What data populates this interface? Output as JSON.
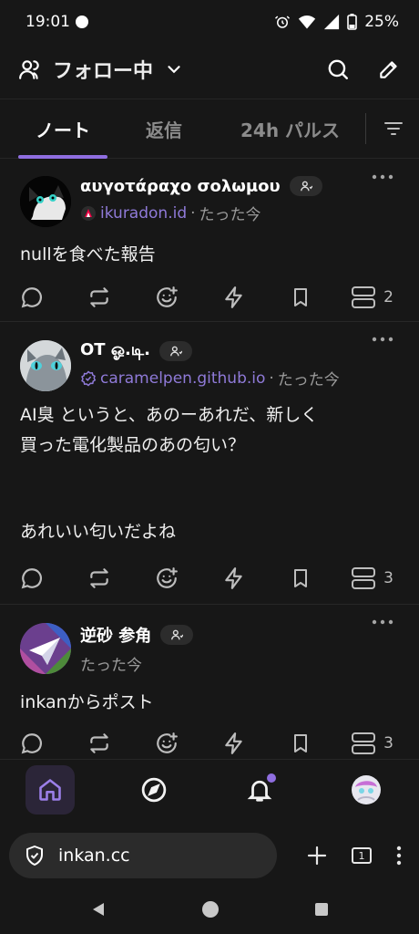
{
  "status_bar": {
    "time": "19:01",
    "battery": "25%"
  },
  "header": {
    "feed_title": "フォロー中"
  },
  "tabs": [
    {
      "label": "ノート",
      "active": true
    },
    {
      "label": "返信",
      "active": false
    },
    {
      "label": "24h パルス",
      "active": false
    }
  ],
  "posts": [
    {
      "display_name": "αυγοτάραχο σολωμου",
      "instance": "ikuradon.id",
      "time": "たった今",
      "text": "nullを食べた報告",
      "server_count": "2"
    },
    {
      "display_name": "OT ஓ.டி.",
      "instance": "caramelpen.github.io",
      "time": "たった今",
      "text_lines": [
        "AI臭 というと、あのーあれだ、新しく",
        "買った電化製品のあの匂い？",
        "",
        "",
        "あれいい匂いだよね"
      ],
      "server_count": "3"
    },
    {
      "display_name": "逆砂 参角",
      "time": "たった今",
      "text": "inkanからポスト",
      "server_count": "3"
    }
  ],
  "browser": {
    "url": "inkan.cc",
    "tab_count": "1"
  },
  "colors": {
    "accent": "#8f6ee0",
    "background": "#171717",
    "instance": "#8f7ad8"
  },
  "icons": [
    "users-icon",
    "chevron-down-icon",
    "search-icon",
    "compose-icon",
    "filter-icon",
    "more-icon",
    "reply-icon",
    "renote-icon",
    "reaction-icon",
    "boost-icon",
    "bookmark-icon",
    "server-icon",
    "home-icon",
    "compass-icon",
    "bell-icon",
    "avatar",
    "shield-icon",
    "plus-icon",
    "tabs-icon",
    "menu-icon"
  ]
}
